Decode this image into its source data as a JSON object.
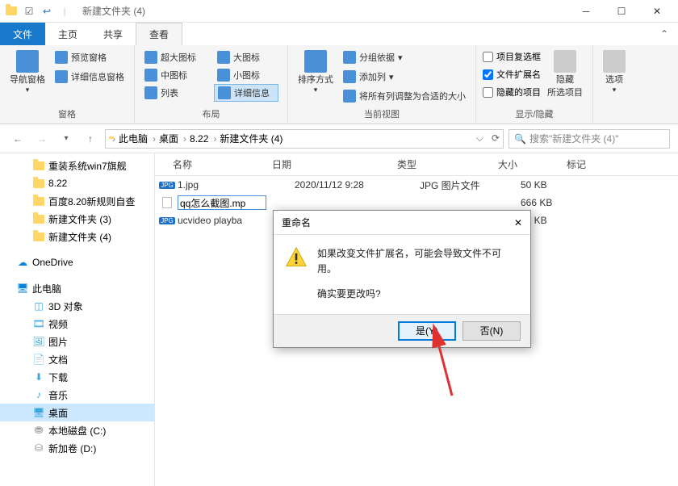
{
  "title": "新建文件夹 (4)",
  "tabs": {
    "file": "文件",
    "home": "主页",
    "share": "共享",
    "view": "查看"
  },
  "ribbon": {
    "panes": {
      "label": "窗格",
      "nav_pane": "导航窗格",
      "preview": "预览窗格",
      "details": "详细信息窗格"
    },
    "layout": {
      "label": "布局",
      "xlarge": "超大图标",
      "large": "大图标",
      "medium": "中图标",
      "small": "小图标",
      "list": "列表",
      "details": "详细信息"
    },
    "current_view": {
      "label": "当前视图",
      "sort": "排序方式",
      "groupby": "分组依据",
      "addcol": "添加列",
      "autosize": "将所有列调整为合适的大小"
    },
    "showhide": {
      "label": "显示/隐藏",
      "checkboxes": "项目复选框",
      "extensions": "文件扩展名",
      "hidden": "隐藏的项目",
      "hide_btn": "隐藏\n所选项目"
    },
    "options": "选项"
  },
  "breadcrumbs": [
    "此电脑",
    "桌面",
    "8.22",
    "新建文件夹 (4)"
  ],
  "search_placeholder": "搜索\"新建文件夹 (4)\"",
  "sidebar": {
    "quick": [
      {
        "label": "重装系统win7旗舰"
      },
      {
        "label": "8.22"
      },
      {
        "label": "百度8.20新规则自查"
      },
      {
        "label": "新建文件夹 (3)"
      },
      {
        "label": "新建文件夹 (4)"
      }
    ],
    "onedrive": "OneDrive",
    "thispc": "此电脑",
    "thispc_items": [
      "3D 对象",
      "视频",
      "图片",
      "文档",
      "下载",
      "音乐",
      "桌面",
      "本地磁盘 (C:)",
      "新加卷 (D:)"
    ]
  },
  "columns": {
    "name": "名称",
    "date": "日期",
    "type": "类型",
    "size": "大小",
    "tag": "标记"
  },
  "files": [
    {
      "name": "1.jpg",
      "date": "2020/11/12 9:28",
      "type": "JPG 图片文件",
      "size": "50 KB",
      "icon": "jpg"
    },
    {
      "name": "qq怎么截图.mp",
      "date": "",
      "type": "",
      "size": "666 KB",
      "icon": "file",
      "renaming": true
    },
    {
      "name": "ucvideo playba",
      "date": "",
      "type": "",
      "size": "89 KB",
      "icon": "jpg"
    }
  ],
  "dialog": {
    "title": "重命名",
    "line1": "如果改变文件扩展名，可能会导致文件不可用。",
    "line2": "确实要更改吗?",
    "yes": "是(Y)",
    "no": "否(N)"
  }
}
